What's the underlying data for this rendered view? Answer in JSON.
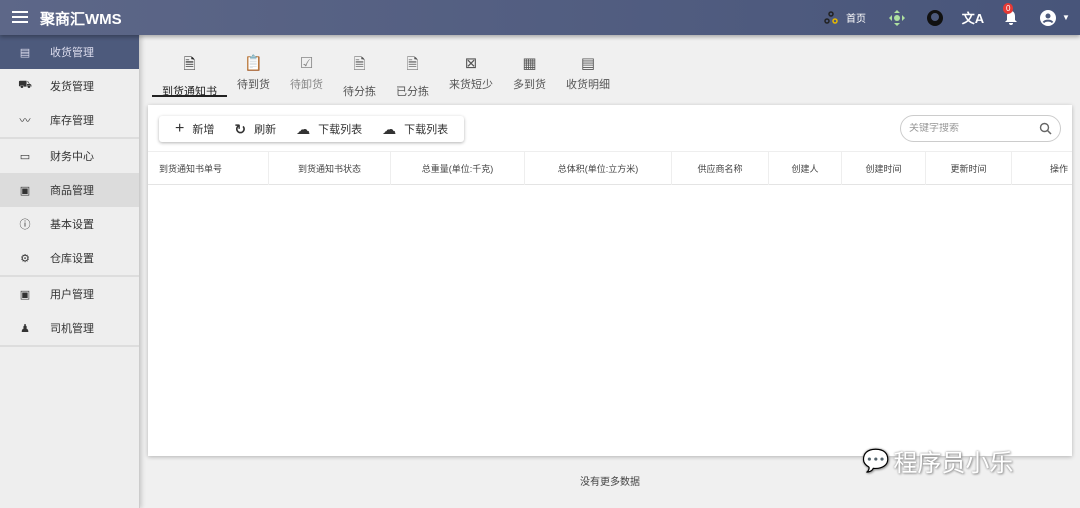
{
  "header": {
    "title": "聚商汇WMS",
    "home": "首页",
    "notification_count": "0"
  },
  "sidebar": {
    "items": [
      {
        "label": "收货管理",
        "icon": "receipt-icon"
      },
      {
        "label": "发货管理",
        "icon": "truck-icon"
      },
      {
        "label": "库存管理",
        "icon": "trend-icon"
      },
      {
        "label": "财务中心",
        "icon": "devices-icon"
      },
      {
        "label": "商品管理",
        "icon": "product-icon"
      },
      {
        "label": "基本设置",
        "icon": "info-icon"
      },
      {
        "label": "仓库设置",
        "icon": "gear-icon"
      },
      {
        "label": "用户管理",
        "icon": "user-badge-icon"
      },
      {
        "label": "司机管理",
        "icon": "driver-icon"
      }
    ]
  },
  "tabs": [
    {
      "label": "到货通知书"
    },
    {
      "label": "待到货"
    },
    {
      "label": "待卸货"
    },
    {
      "label": "待分拣"
    },
    {
      "label": "已分拣"
    },
    {
      "label": "来货短少"
    },
    {
      "label": "多到货"
    },
    {
      "label": "收货明细"
    }
  ],
  "toolbar": {
    "add": "新增",
    "refresh": "刷新",
    "download1": "下载列表",
    "download2": "下载列表"
  },
  "search": {
    "placeholder": "关键字搜索",
    "value": ""
  },
  "table": {
    "columns": [
      "到货通知书单号",
      "到货通知书状态",
      "总重量(单位:千克)",
      "总体积(单位:立方米)",
      "供应商名称",
      "创建人",
      "创建时间",
      "更新时间",
      "操作"
    ]
  },
  "footer": {
    "no_more": "没有更多数据"
  },
  "watermark": "程序员小乐"
}
